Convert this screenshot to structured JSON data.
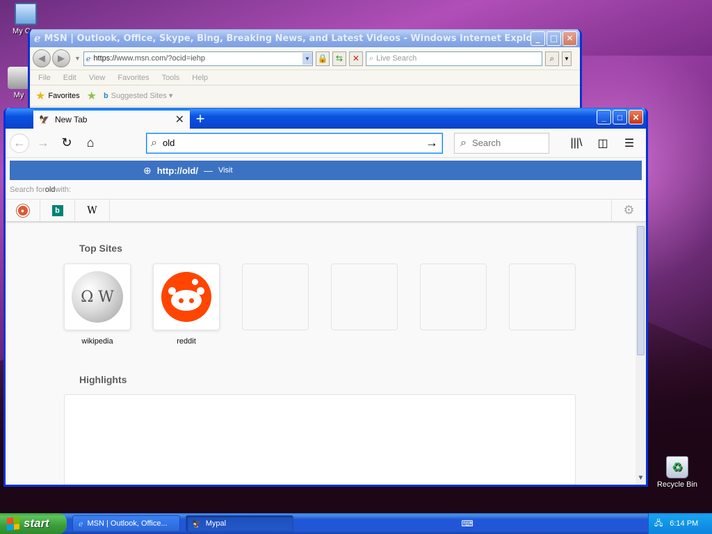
{
  "desktop": {
    "icons": [
      {
        "label": "My Computer",
        "short": "My Con"
      },
      {
        "label": "My Network",
        "short": "My"
      },
      {
        "label": "Recycle Bin"
      }
    ]
  },
  "ie": {
    "title": "MSN | Outlook, Office, Skype, Bing, Breaking News, and Latest Videos - Windows Internet Explorer",
    "url_proto": "https://",
    "url_rest": "www.msn.com/?ocid=iehp",
    "search_placeholder": "Live Search",
    "menu": [
      "File",
      "Edit",
      "View",
      "Favorites",
      "Tools",
      "Help"
    ],
    "favorites_label": "Favorites",
    "suggested_label": "Suggested Sites ▾"
  },
  "firefox": {
    "tab_title": "New Tab",
    "url_value": "old",
    "search_placeholder": "Search",
    "suggestion_url": "http://old/",
    "suggestion_dash": "—",
    "suggestion_action": "Visit",
    "search_with_prefix": "Search for ",
    "search_with_term": "old",
    "search_with_suffix": " with:",
    "engines": [
      "DuckDuckGo",
      "Bing",
      "Wikipedia"
    ],
    "top_sites_title": "Top Sites",
    "top_sites": [
      {
        "label": "wikipedia"
      },
      {
        "label": "reddit"
      },
      {
        "label": ""
      },
      {
        "label": ""
      },
      {
        "label": ""
      },
      {
        "label": ""
      }
    ],
    "highlights_title": "Highlights"
  },
  "taskbar": {
    "start_label": "start",
    "items": [
      {
        "label": "MSN | Outlook, Office..."
      },
      {
        "label": "Mypal"
      }
    ],
    "clock": "6:14 PM"
  },
  "colors": {
    "xp_blue": "#0831d9",
    "ff_accent": "#0a84ff",
    "suggestion_bg": "#3c72c2",
    "reddit": "#ff4500"
  }
}
